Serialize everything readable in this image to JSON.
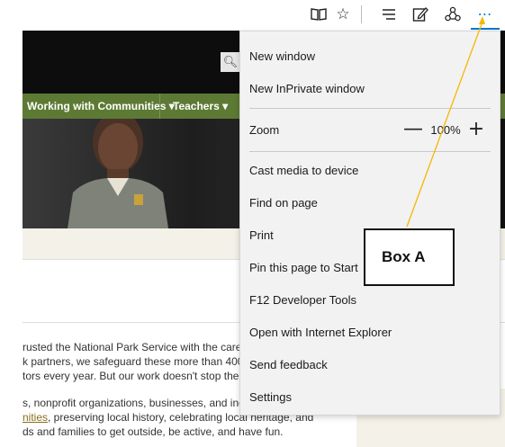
{
  "toolbar": {
    "icons": [
      "reading-view-icon",
      "favorites-star-icon",
      "hub-icon",
      "web-note-icon",
      "share-icon",
      "more-actions-icon"
    ],
    "more_label": "⋯"
  },
  "page": {
    "nav": [
      {
        "label": "Working with Communities ▾"
      },
      {
        "label": "Teachers ▾"
      }
    ],
    "paragraphs": [
      "rusted the National Park Service with the care of",
      "k partners, we safeguard these more than 400 pla",
      "tors every year. But our work doesn't stop there.",
      "s, nonprofit organizations, businesses, and indivi"
    ],
    "link_text": "nities",
    "link_tail": ", preserving local history, celebrating local heritage, and",
    "last_line": "ds and families to get outside, be active, and have fun."
  },
  "menu": {
    "items": [
      {
        "label": "New window"
      },
      {
        "label": "New InPrivate window"
      },
      {
        "label": "Cast media to device"
      },
      {
        "label": "Find on page"
      },
      {
        "label": "Print"
      },
      {
        "label": "Pin this page to Start"
      },
      {
        "label": "F12 Developer Tools"
      },
      {
        "label": "Open with Internet Explorer"
      },
      {
        "label": "Send feedback"
      },
      {
        "label": "Settings"
      }
    ],
    "zoom": {
      "label": "Zoom",
      "minus": "—",
      "value": "100%",
      "plus": "+"
    }
  },
  "annotation": {
    "label": "Box A",
    "color": "#f5b800"
  },
  "colors": {
    "accent": "#0078d7",
    "nav_green": "#5d7a34",
    "menu_bg": "#f2f2f2"
  }
}
